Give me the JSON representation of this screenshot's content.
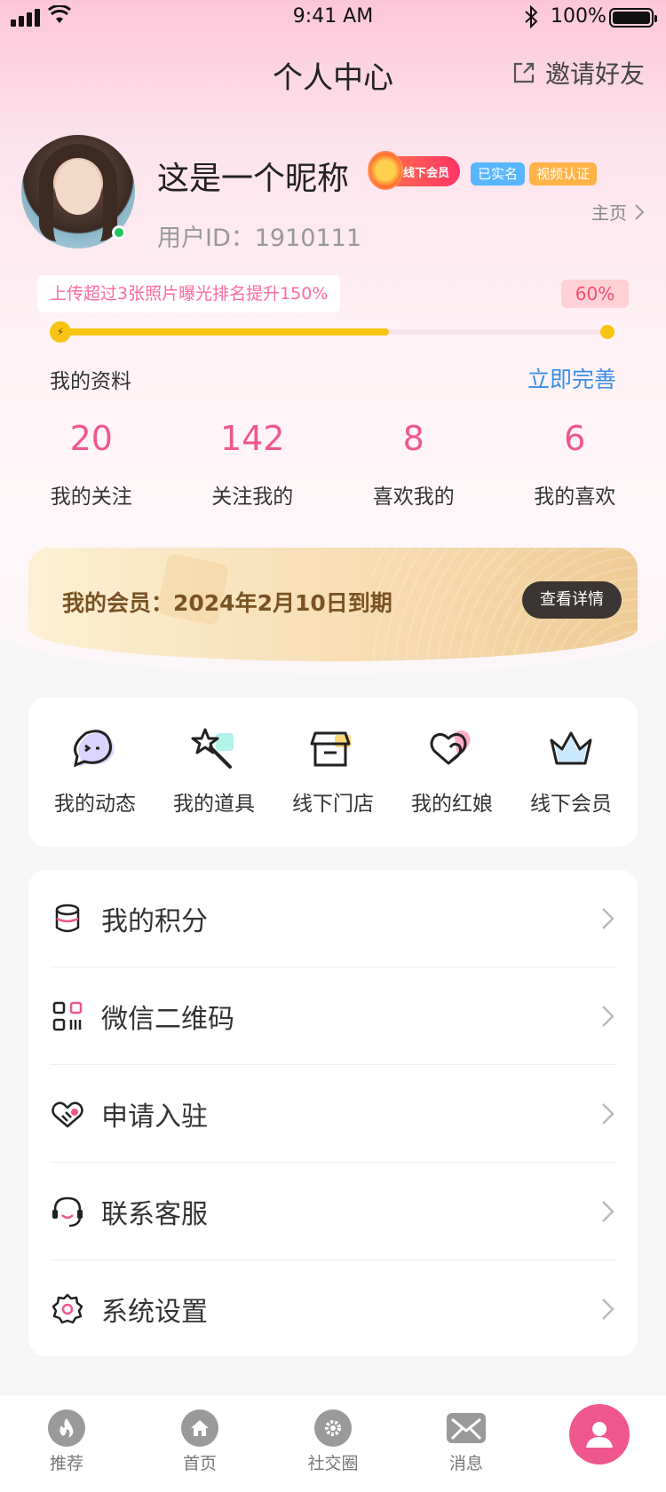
{
  "status_bar": {
    "time": "9:41 AM",
    "battery": "100%"
  },
  "header": {
    "title": "个人中心",
    "invite_label": "邀请好友"
  },
  "profile": {
    "nickname": "这是一个昵称",
    "vip_badge": "线下会员",
    "tag_verified": "已实名",
    "tag_video": "视频认证",
    "user_id": "用户ID：1910111",
    "homepage_label": "主页",
    "online": true
  },
  "progress": {
    "tip": "上传超过3张照片曝光排名提升150%",
    "percent_text": "60%",
    "percent_value": 0.6,
    "profile_label": "我的资料",
    "complete_label": "立即完善"
  },
  "stats": [
    {
      "value": "20",
      "label": "我的关注"
    },
    {
      "value": "142",
      "label": "关注我的"
    },
    {
      "value": "8",
      "label": "喜欢我的"
    },
    {
      "value": "6",
      "label": "我的喜欢"
    }
  ],
  "membership": {
    "text": "我的会员：2024年2月10日到期",
    "button": "查看详情"
  },
  "quick_links": [
    {
      "label": "我的动态",
      "icon": "chat-bubble-icon"
    },
    {
      "label": "我的道具",
      "icon": "magic-wand-icon"
    },
    {
      "label": "线下门店",
      "icon": "store-icon"
    },
    {
      "label": "我的红娘",
      "icon": "hearts-icon"
    },
    {
      "label": "线下会员",
      "icon": "crown-icon"
    }
  ],
  "menu": [
    {
      "label": "我的积分",
      "icon": "coins-icon"
    },
    {
      "label": "微信二维码",
      "icon": "qr-code-icon"
    },
    {
      "label": "申请入驻",
      "icon": "handshake-heart-icon"
    },
    {
      "label": "联系客服",
      "icon": "headset-icon"
    },
    {
      "label": "系统设置",
      "icon": "settings-gear-icon"
    }
  ],
  "tabbar": [
    {
      "label": "推荐",
      "icon": "flame-icon"
    },
    {
      "label": "首页",
      "icon": "home-icon"
    },
    {
      "label": "社交圈",
      "icon": "gear-icon"
    },
    {
      "label": "消息",
      "icon": "envelope-icon"
    },
    {
      "label": "",
      "icon": "user-icon",
      "active": true
    }
  ],
  "colors": {
    "accent_pink": "#f0578e",
    "link_blue": "#3a8fe8",
    "progress_yellow": "#f8c414"
  }
}
